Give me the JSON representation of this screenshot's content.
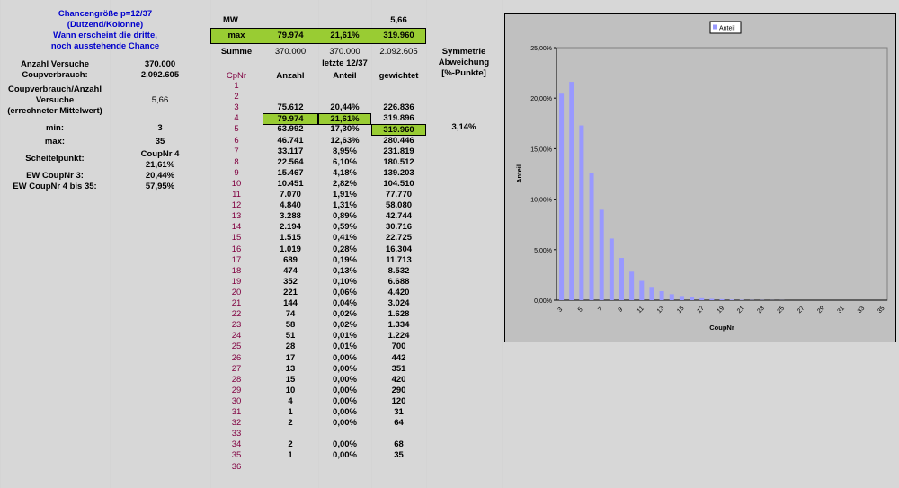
{
  "title_block": {
    "line1": "Chancengröße p=12/37",
    "line2": "(Dutzend/Kolonne)",
    "line3": "Wann erscheint die dritte,",
    "line4": "noch ausstehende Chance"
  },
  "header": {
    "mw_label": "MW",
    "mw_value": "5,66",
    "max_label": "max",
    "max_anzahl": "79.974",
    "max_anteil": "21,61%",
    "max_gewichtet": "319.960",
    "summe_label": "Summe",
    "summe_anzahl": "370.000",
    "summe_anteil": "370.000",
    "summe_gewichtet": "2.092.605",
    "symmetrie_l1": "Symmetrie",
    "symmetrie_l2": "Abweichung",
    "symmetrie_l3": "[%-Punkte]",
    "letzte_label": "letzte 12/37",
    "col_cpnr": "CpNr",
    "col_anzahl": "Anzahl",
    "col_anteil": "Anteil",
    "col_gewichtet": "gewichtet",
    "symmetrie_value": "3,14%"
  },
  "left_stats": {
    "versuche_label": "Anzahl Versuche",
    "versuche_value": "370.000",
    "verbrauch_label": "Coupverbrauch:",
    "verbrauch_value": "2.092.605",
    "cv_l1": "Coupverbrauch/Anzahl",
    "cv_l2": "Versuche",
    "cv_l3": "(errechneter Mittelwert)",
    "cv_value": "5,66",
    "min_label": "min:",
    "min_value": "3",
    "max_label": "max:",
    "max_value": "35",
    "scheitel_label": "Scheitelpunkt:",
    "scheitel_v1": "CoupNr 4",
    "scheitel_v2": "21,61%",
    "ew3_label": "EW CoupNr 3:",
    "ew3_value": "20,44%",
    "ew4_label": "EW CoupNr 4 bis 35:",
    "ew4_value": "57,95%"
  },
  "rows": [
    {
      "cp": "1",
      "anzahl": "",
      "anteil": "",
      "gew": ""
    },
    {
      "cp": "2",
      "anzahl": "",
      "anteil": "",
      "gew": ""
    },
    {
      "cp": "3",
      "anzahl": "75.612",
      "anteil": "20,44%",
      "gew": "226.836"
    },
    {
      "cp": "4",
      "anzahl": "79.974",
      "anteil": "21,61%",
      "gew": "319.896"
    },
    {
      "cp": "5",
      "anzahl": "63.992",
      "anteil": "17,30%",
      "gew": "319.960"
    },
    {
      "cp": "6",
      "anzahl": "46.741",
      "anteil": "12,63%",
      "gew": "280.446"
    },
    {
      "cp": "7",
      "anzahl": "33.117",
      "anteil": "8,95%",
      "gew": "231.819"
    },
    {
      "cp": "8",
      "anzahl": "22.564",
      "anteil": "6,10%",
      "gew": "180.512"
    },
    {
      "cp": "9",
      "anzahl": "15.467",
      "anteil": "4,18%",
      "gew": "139.203"
    },
    {
      "cp": "10",
      "anzahl": "10.451",
      "anteil": "2,82%",
      "gew": "104.510"
    },
    {
      "cp": "11",
      "anzahl": "7.070",
      "anteil": "1,91%",
      "gew": "77.770"
    },
    {
      "cp": "12",
      "anzahl": "4.840",
      "anteil": "1,31%",
      "gew": "58.080"
    },
    {
      "cp": "13",
      "anzahl": "3.288",
      "anteil": "0,89%",
      "gew": "42.744"
    },
    {
      "cp": "14",
      "anzahl": "2.194",
      "anteil": "0,59%",
      "gew": "30.716"
    },
    {
      "cp": "15",
      "anzahl": "1.515",
      "anteil": "0,41%",
      "gew": "22.725"
    },
    {
      "cp": "16",
      "anzahl": "1.019",
      "anteil": "0,28%",
      "gew": "16.304"
    },
    {
      "cp": "17",
      "anzahl": "689",
      "anteil": "0,19%",
      "gew": "11.713"
    },
    {
      "cp": "18",
      "anzahl": "474",
      "anteil": "0,13%",
      "gew": "8.532"
    },
    {
      "cp": "19",
      "anzahl": "352",
      "anteil": "0,10%",
      "gew": "6.688"
    },
    {
      "cp": "20",
      "anzahl": "221",
      "anteil": "0,06%",
      "gew": "4.420"
    },
    {
      "cp": "21",
      "anzahl": "144",
      "anteil": "0,04%",
      "gew": "3.024"
    },
    {
      "cp": "22",
      "anzahl": "74",
      "anteil": "0,02%",
      "gew": "1.628"
    },
    {
      "cp": "23",
      "anzahl": "58",
      "anteil": "0,02%",
      "gew": "1.334"
    },
    {
      "cp": "24",
      "anzahl": "51",
      "anteil": "0,01%",
      "gew": "1.224"
    },
    {
      "cp": "25",
      "anzahl": "28",
      "anteil": "0,01%",
      "gew": "700"
    },
    {
      "cp": "26",
      "anzahl": "17",
      "anteil": "0,00%",
      "gew": "442"
    },
    {
      "cp": "27",
      "anzahl": "13",
      "anteil": "0,00%",
      "gew": "351"
    },
    {
      "cp": "28",
      "anzahl": "15",
      "anteil": "0,00%",
      "gew": "420"
    },
    {
      "cp": "29",
      "anzahl": "10",
      "anteil": "0,00%",
      "gew": "290"
    },
    {
      "cp": "30",
      "anzahl": "4",
      "anteil": "0,00%",
      "gew": "120"
    },
    {
      "cp": "31",
      "anzahl": "1",
      "anteil": "0,00%",
      "gew": "31"
    },
    {
      "cp": "32",
      "anzahl": "2",
      "anteil": "0,00%",
      "gew": "64"
    },
    {
      "cp": "33",
      "anzahl": "",
      "anteil": "",
      "gew": ""
    },
    {
      "cp": "34",
      "anzahl": "2",
      "anteil": "0,00%",
      "gew": "68"
    },
    {
      "cp": "35",
      "anzahl": "1",
      "anteil": "0,00%",
      "gew": "35"
    },
    {
      "cp": "36",
      "anzahl": "",
      "anteil": "",
      "gew": ""
    }
  ],
  "chart_data": {
    "type": "bar",
    "legend": "Anteil",
    "legend_position": "top-right",
    "xlabel": "CoupNr",
    "ylabel": "Anteil",
    "ylim": [
      0,
      0.25
    ],
    "yticks": [
      "0,00%",
      "5,00%",
      "10,00%",
      "15,00%",
      "20,00%",
      "25,00%"
    ],
    "xticks": [
      "3",
      "5",
      "7",
      "9",
      "11",
      "13",
      "15",
      "17",
      "19",
      "21",
      "23",
      "25",
      "27",
      "29",
      "31",
      "33",
      "35"
    ],
    "categories": [
      "3",
      "4",
      "5",
      "6",
      "7",
      "8",
      "9",
      "10",
      "11",
      "12",
      "13",
      "14",
      "15",
      "16",
      "17",
      "18",
      "19",
      "20",
      "21",
      "22",
      "23",
      "24",
      "25",
      "26",
      "27",
      "28",
      "29",
      "30",
      "31",
      "32",
      "33",
      "34",
      "35"
    ],
    "values": [
      0.2044,
      0.2161,
      0.173,
      0.1263,
      0.0895,
      0.061,
      0.0418,
      0.0282,
      0.0191,
      0.0131,
      0.0089,
      0.0059,
      0.0041,
      0.0028,
      0.0019,
      0.0013,
      0.001,
      0.0006,
      0.0004,
      0.0002,
      0.0002,
      0.0001,
      0.0001,
      0,
      0,
      0,
      0,
      0,
      0,
      0,
      0,
      0,
      0
    ],
    "bar_color": "#9999ff",
    "plot_bg": "#c0c0c0"
  }
}
